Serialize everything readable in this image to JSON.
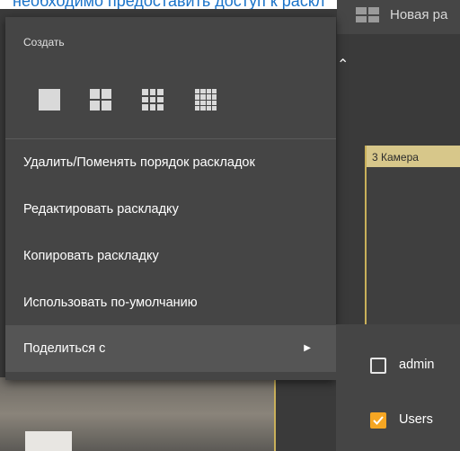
{
  "background": {
    "top_text": "необходимо предоставить доступ к раскл",
    "layout_name": "Новая ра",
    "camera_tile_title": "3 Камера"
  },
  "menu": {
    "header": "Создать",
    "grid_icons": [
      "grid-1x1-icon",
      "grid-2x2-icon",
      "grid-3x3-icon",
      "grid-4x4-icon"
    ],
    "items": [
      {
        "label": "Удалить/Поменять порядок раскладок"
      },
      {
        "label": "Редактировать раскладку"
      },
      {
        "label": "Копировать раскладку"
      },
      {
        "label": "Использовать по-умолчанию"
      },
      {
        "label": "Поделиться с",
        "has_submenu": true
      }
    ]
  },
  "submenu": {
    "items": [
      {
        "label": "admin",
        "checked": false
      },
      {
        "label": "Users",
        "checked": true
      }
    ]
  },
  "colors": {
    "menu_bg": "#454545",
    "active_bg": "#555555",
    "accent": "#f5a623",
    "camera_title_bg": "#d7c78a"
  }
}
